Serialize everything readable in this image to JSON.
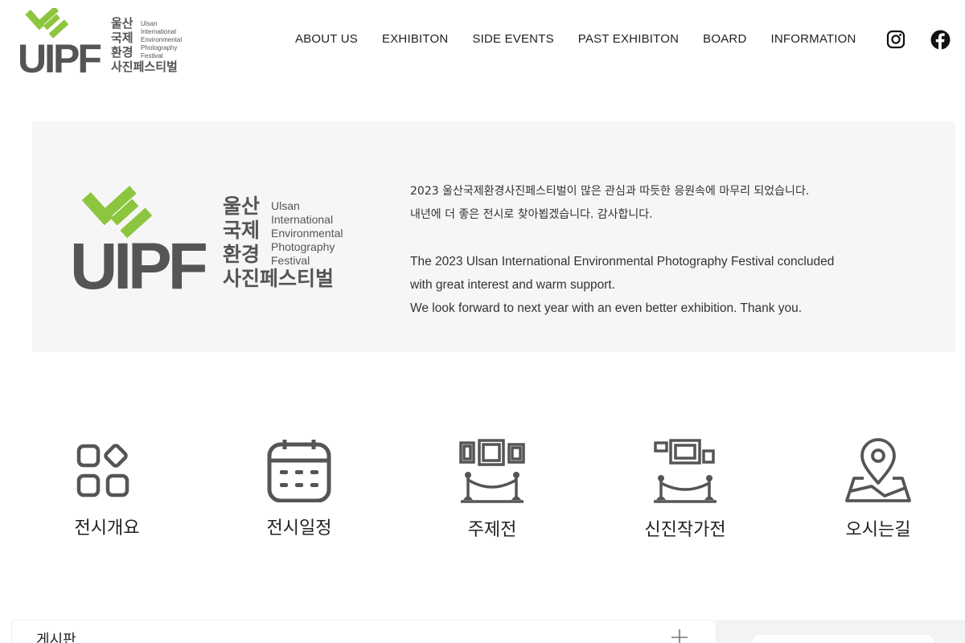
{
  "brand": {
    "logo_mark": "UIPF",
    "logo_korean_lines": [
      "울산",
      "국제",
      "환경",
      "사진페스티벌"
    ],
    "logo_english_lines": [
      "Ulsan",
      "International",
      "Environmental",
      "Photography",
      "Festival"
    ],
    "accent_color": "#8cc63f",
    "dark_color": "#555555"
  },
  "nav": {
    "items": [
      "ABOUT US",
      "EXHIBITON",
      "SIDE EVENTS",
      "PAST EXHIBITON",
      "BOARD",
      "INFORMATION"
    ]
  },
  "social": {
    "instagram_icon": "instagram-icon",
    "facebook_icon": "facebook-icon"
  },
  "banner": {
    "ko_line1": "2023 울산국제환경사진페스티벌이 많은 관심과 따듯한 응원속에 마무리 되었습니다.",
    "ko_line2": "내년에 더 좋은 전시로 찾아뵙겠습니다.  감사합니다.",
    "en_line1": "The 2023 Ulsan International Environmental Photography Festival concluded",
    "en_line2": "with great interest and warm support.",
    "en_line3": "We look forward to  next year with an even better exhibition. Thank you."
  },
  "quick_menu": {
    "items": [
      {
        "label": "전시개요",
        "icon": "grid-apps-icon"
      },
      {
        "label": "전시일정",
        "icon": "calendar-icon"
      },
      {
        "label": "주제전",
        "icon": "gallery-exhibit-icon"
      },
      {
        "label": "신진작가전",
        "icon": "gallery-frame-icon"
      },
      {
        "label": "오시는길",
        "icon": "map-pin-icon"
      }
    ]
  },
  "board": {
    "title": "게시판",
    "more_icon": "plus-icon"
  }
}
